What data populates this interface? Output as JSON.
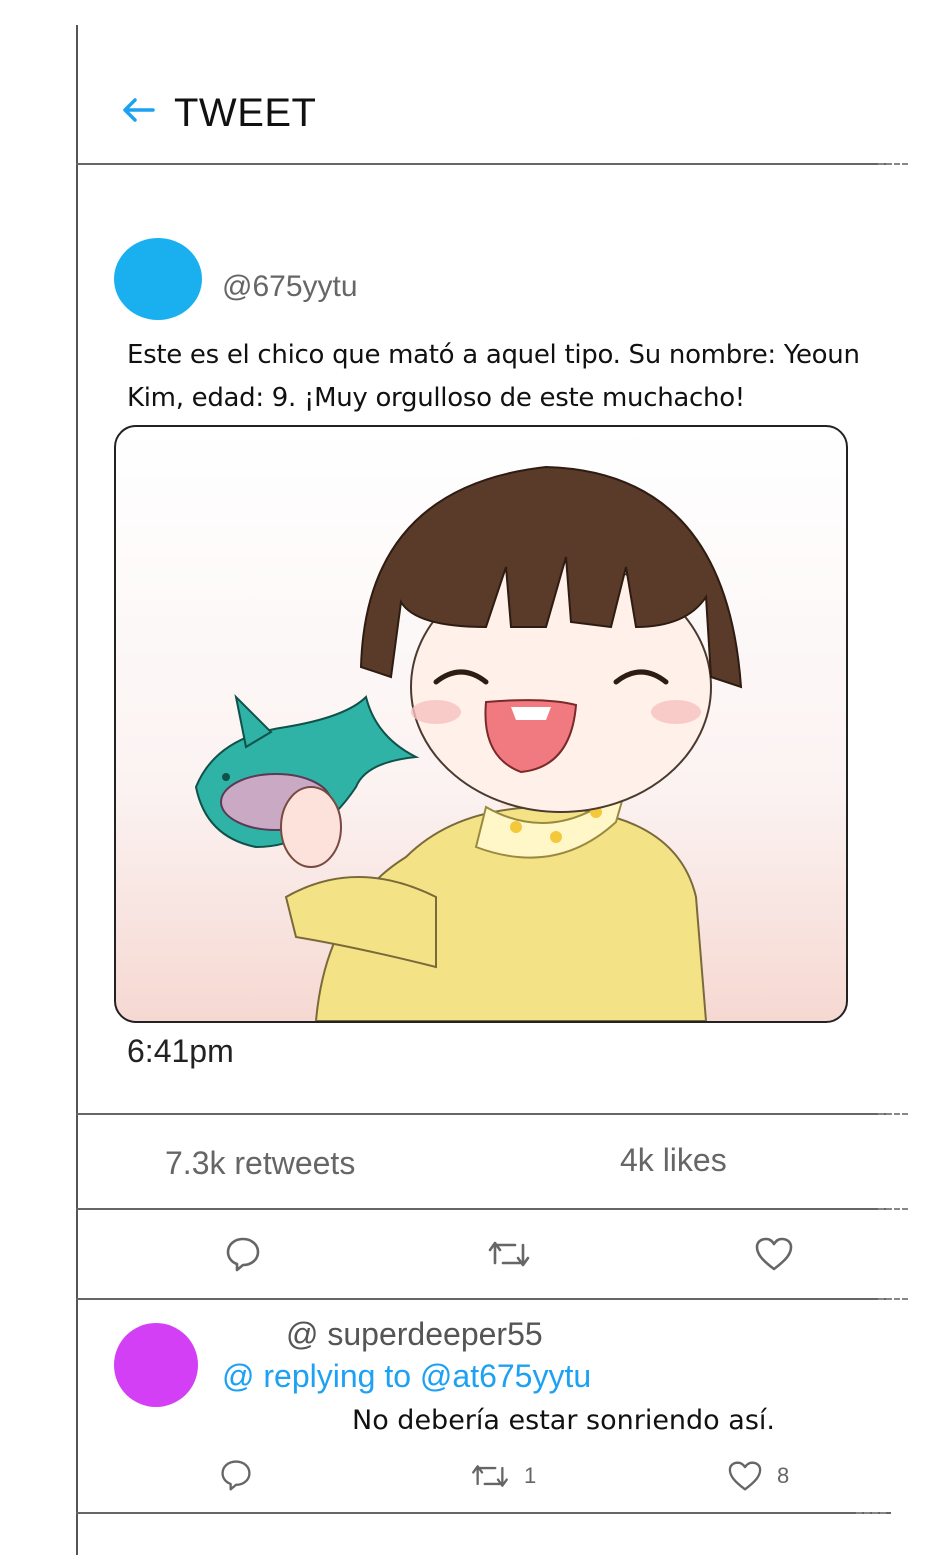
{
  "header": {
    "back_icon": "arrow-left-icon",
    "title": "TWEET",
    "accent_color": "#1da1f2"
  },
  "tweet": {
    "avatar_color": "#1ab0f0",
    "handle": "@675yytu",
    "text": "Este es el chico que mató a aquel tipo. Su nombre: Yeoun Kim, edad: 9. ¡Muy orgulloso de este muchacho!",
    "time": "6:41pm"
  },
  "stats": {
    "retweets": "7.3k retweets",
    "likes": "4k likes"
  },
  "actions": {
    "reply_icon": "comment-icon",
    "retweet_icon": "retweet-icon",
    "like_icon": "heart-icon"
  },
  "reply": {
    "avatar_color": "#d33ff4",
    "handle": "@ superdeeper55",
    "replying_to": "@ replying to @at675yytu",
    "text": "No debería estar sonriendo así.",
    "retweet_count": "1",
    "like_count": "8"
  }
}
